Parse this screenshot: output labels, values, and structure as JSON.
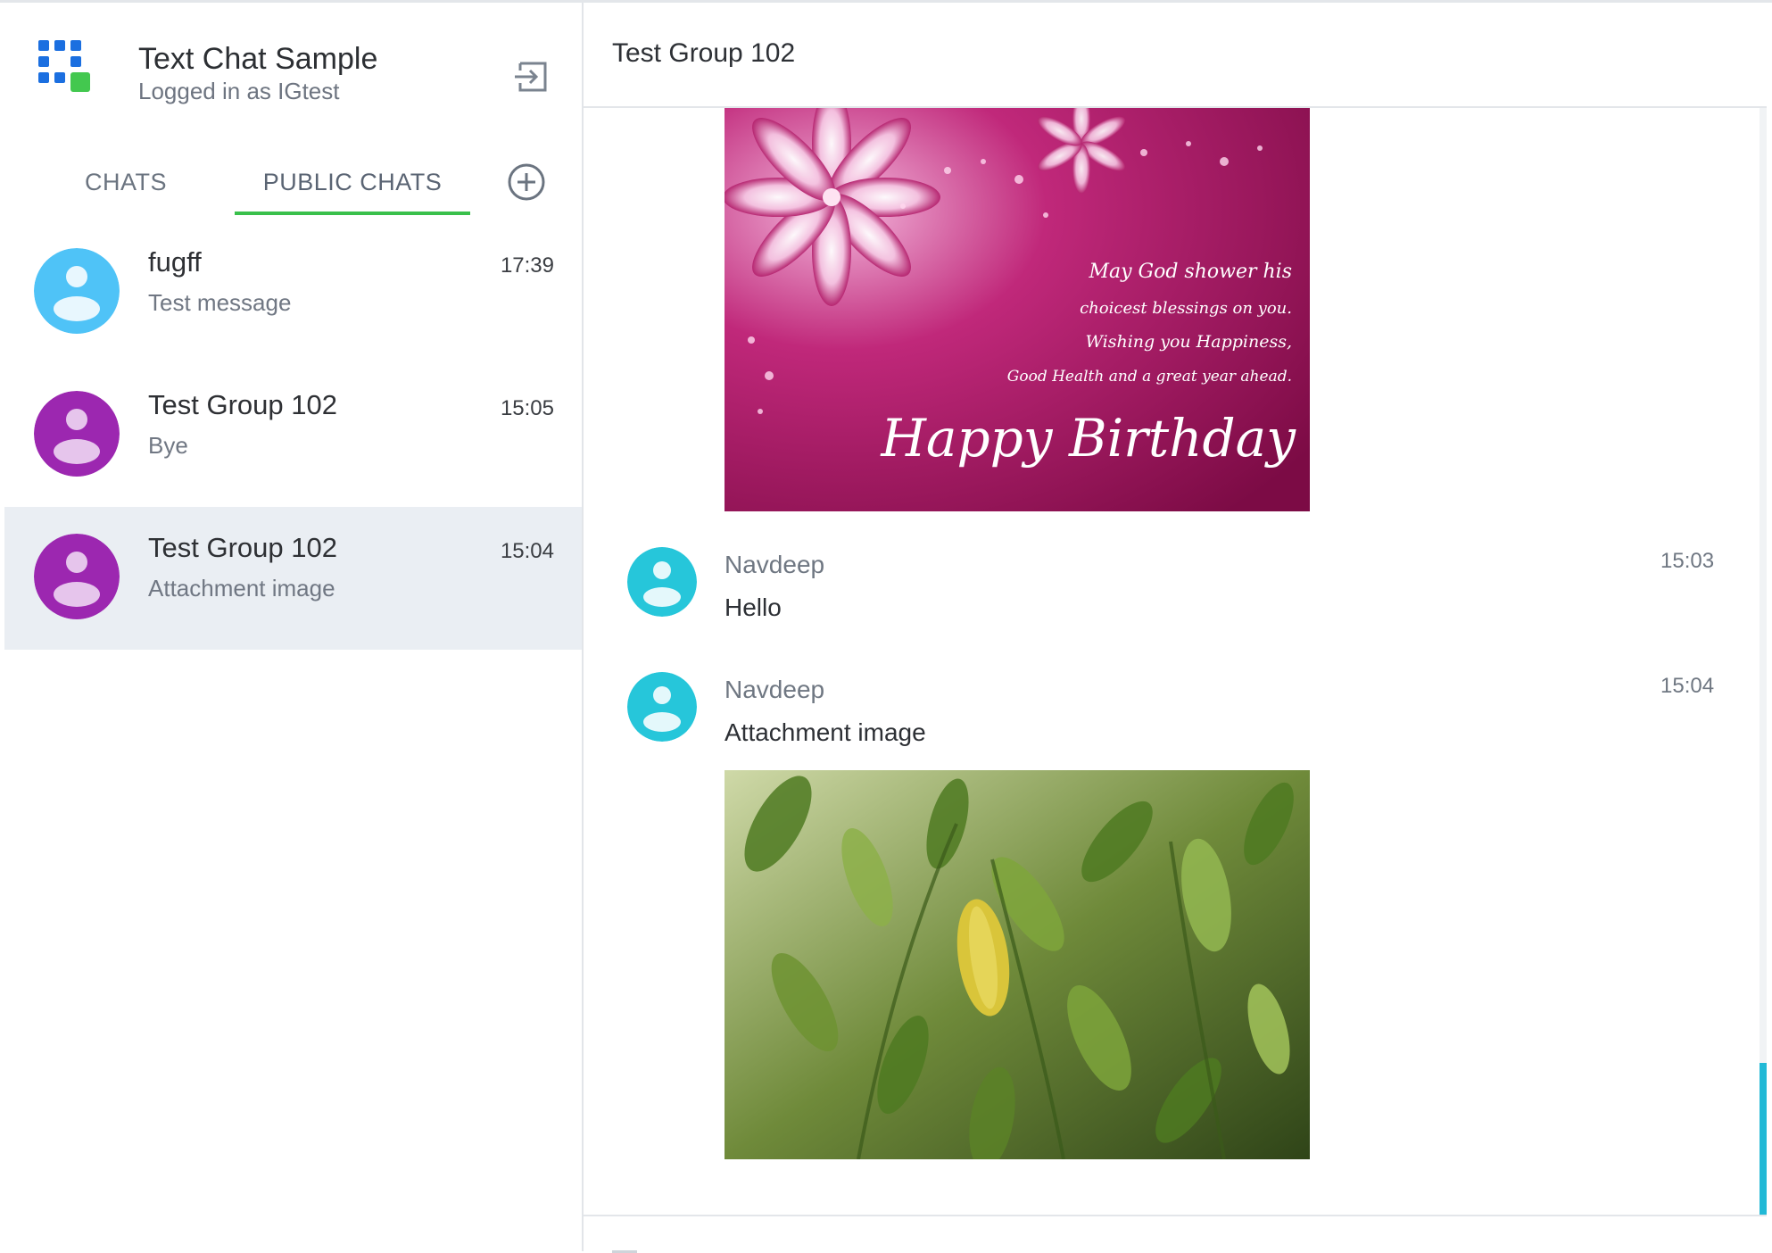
{
  "app": {
    "title": "Text Chat Sample",
    "subtitle": "Logged in as IGtest",
    "logout_icon": "logout-icon",
    "colors": {
      "accent": "#39c04b",
      "logo_blue": "#1b6fe0",
      "logo_green": "#43c84f"
    }
  },
  "tabs": [
    {
      "label": "CHATS",
      "active": false
    },
    {
      "label": "PUBLIC CHATS",
      "active": true
    }
  ],
  "chats": [
    {
      "name": "fugff",
      "preview": "Test message",
      "time": "17:39",
      "avatar_color": "#4fc3f7",
      "active": false
    },
    {
      "name": "Test Group 102",
      "preview": "Bye",
      "time": "15:05",
      "avatar_color": "#9c27b0",
      "active": false
    },
    {
      "name": "Test Group 102",
      "preview": "Attachment image",
      "time": "15:04",
      "avatar_color": "#9c27b0",
      "active": true
    }
  ],
  "conversation": {
    "title": "Test Group 102",
    "birthday_card": {
      "lines": [
        "May God shower his",
        "choicest blessings on you.",
        "Wishing you Happiness,",
        "Good Health and a great year ahead."
      ],
      "headline": "Happy Birthday"
    },
    "messages": [
      {
        "author": "Navdeep",
        "text": "Hello",
        "time": "15:03",
        "avatar_color": "#26c6da"
      },
      {
        "author": "Navdeep",
        "text": "Attachment image",
        "time": "15:04",
        "avatar_color": "#26c6da"
      }
    ]
  }
}
